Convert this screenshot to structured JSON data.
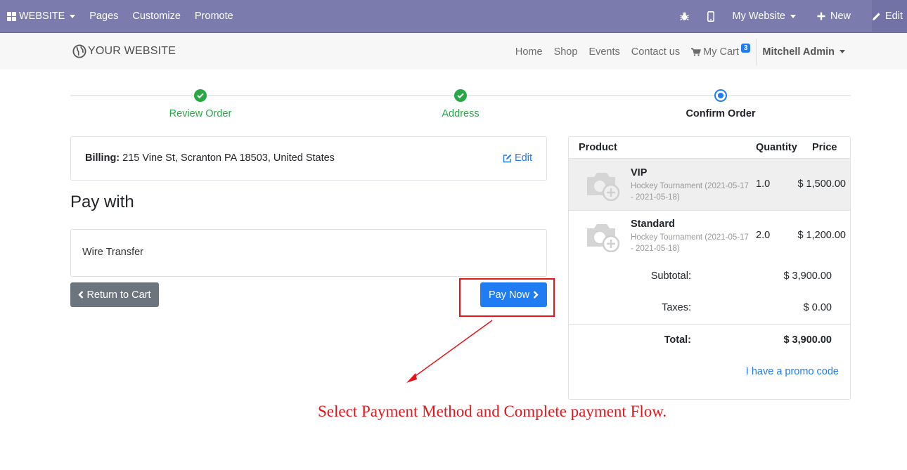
{
  "admin_bar": {
    "apps_label": "WEBSITE",
    "menu": [
      "Pages",
      "Customize",
      "Promote"
    ],
    "site_selector": "My Website",
    "new_label": "New",
    "edit_label": "Edit"
  },
  "header": {
    "logo_text": "YOUR WEBSITE",
    "nav": [
      "Home",
      "Shop",
      "Events",
      "Contact us"
    ],
    "cart_label": "My Cart",
    "cart_count": "3",
    "user_name": "Mitchell Admin"
  },
  "wizard": {
    "steps": [
      {
        "label": "Review Order",
        "state": "done"
      },
      {
        "label": "Address",
        "state": "done"
      },
      {
        "label": "Confirm Order",
        "state": "current"
      }
    ]
  },
  "billing": {
    "label": "Billing:",
    "address": "215 Vine St, Scranton PA 18503, United States",
    "edit_label": "Edit"
  },
  "payment": {
    "heading": "Pay with",
    "option": "Wire Transfer",
    "return_label": "Return to Cart",
    "pay_label": "Pay Now"
  },
  "summary": {
    "columns": {
      "product": "Product",
      "quantity": "Quantity",
      "price": "Price"
    },
    "lines": [
      {
        "name": "VIP",
        "desc": "Hockey Tournament (2021-05-17 - 2021-05-18)",
        "qty": "1.0",
        "price": "$ 1,500.00"
      },
      {
        "name": "Standard",
        "desc": "Hockey Tournament (2021-05-17 - 2021-05-18)",
        "qty": "2.0",
        "price": "$ 1,200.00"
      }
    ],
    "subtotal_label": "Subtotal:",
    "subtotal": "$ 3,900.00",
    "taxes_label": "Taxes:",
    "taxes": "$ 0.00",
    "total_label": "Total:",
    "total": "$ 3,900.00",
    "promo_label": "I have a promo code"
  },
  "annotation": "Select Payment Method and Complete payment Flow.",
  "colors": {
    "admin_bar": "#7c7bad",
    "primary": "#1f7cf2",
    "success": "#28a745",
    "secondary": "#6c757d",
    "annotation": "#e3151a"
  },
  "icons": [
    "apps-icon",
    "bug-icon",
    "mobile-icon",
    "plus-icon",
    "pencil-icon",
    "globe-icon",
    "cart-icon",
    "check-icon",
    "edit-icon",
    "chevron-left-icon",
    "chevron-right-icon",
    "camera-plus-icon"
  ]
}
